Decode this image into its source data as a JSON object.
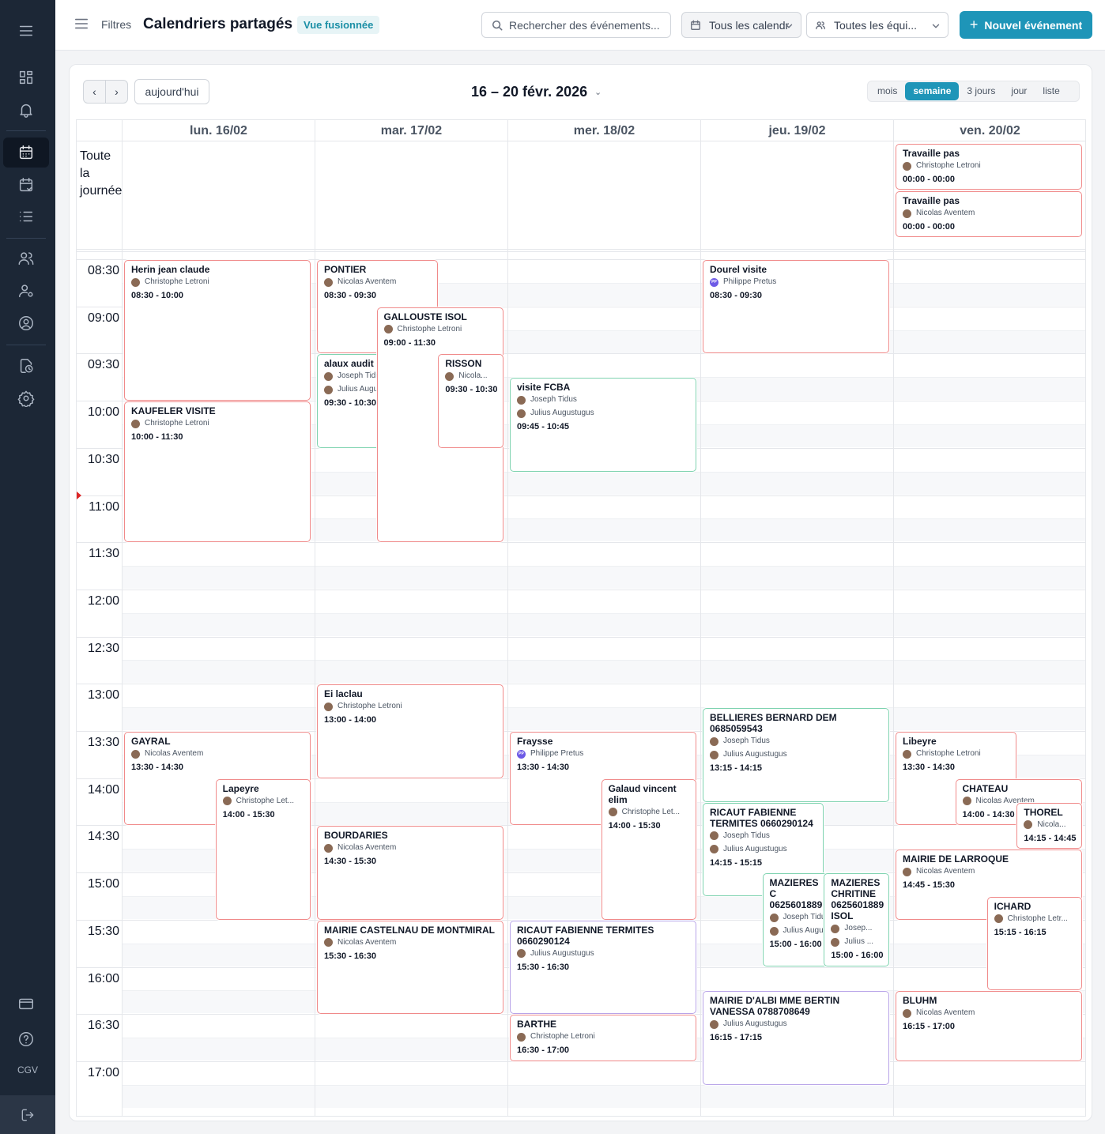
{
  "sidebar": {
    "items": [
      {
        "name": "menu-icon"
      },
      {
        "name": "dashboard-icon"
      },
      {
        "name": "bell-icon"
      },
      {
        "name": "calendar-icon"
      },
      {
        "name": "calendar-check-icon"
      },
      {
        "name": "list-icon"
      },
      {
        "name": "users-icon"
      },
      {
        "name": "user-settings-icon"
      },
      {
        "name": "user-circle-icon"
      },
      {
        "name": "document-time-icon"
      },
      {
        "name": "gear-icon"
      },
      {
        "name": "credit-card-icon"
      },
      {
        "name": "help-icon"
      }
    ],
    "cgv": "CGV",
    "logout_icon": "logout-icon"
  },
  "header": {
    "filters": "Filtres",
    "title": "Calendriers partagés",
    "badge": "Vue fusionnée",
    "search_placeholder": "Rechercher des événements...",
    "calendars_select": "Tous les calendr",
    "teams_select": "Toutes les équi...",
    "new_event": "Nouvel événement"
  },
  "toolbar": {
    "prev": "‹",
    "next": "›",
    "today": "aujourd'hui",
    "range": "16 – 20 févr. 2026",
    "views": [
      "mois",
      "semaine",
      "3 jours",
      "jour",
      "liste"
    ],
    "active_view": "semaine"
  },
  "grid": {
    "allday_label": "Toute la journée",
    "days": [
      "lun. 16/02",
      "mar. 17/02",
      "mer. 18/02",
      "jeu. 19/02",
      "ven. 20/02"
    ],
    "times": [
      "08:30",
      "09:00",
      "09:30",
      "10:00",
      "10:30",
      "11:00",
      "11:30",
      "12:00",
      "12:30",
      "13:00",
      "13:30",
      "14:00",
      "14:30",
      "15:00",
      "15:30",
      "16:00",
      "16:30",
      "17:00"
    ]
  },
  "colors": {
    "accent": "#1e95b8",
    "event_red": "#f08a8a",
    "event_green": "#7fd3b0",
    "event_purple": "#b8a4e8",
    "sidebar": "#1c2736"
  },
  "events": [
    {
      "day": 4,
      "allday": 0,
      "color": "red",
      "title": "Travaille pas",
      "people": [
        "Christophe Letroni"
      ],
      "time": "00:00 - 00:00"
    },
    {
      "day": 4,
      "allday": 1,
      "color": "red",
      "title": "Travaille pas",
      "people": [
        "Nicolas Aventem"
      ],
      "time": "00:00 - 00:00"
    },
    {
      "day": 0,
      "start": "08:30",
      "end": "10:00",
      "col": 0,
      "cols": 1,
      "color": "red",
      "title": "Herin jean claude",
      "people": [
        "Christophe Letroni"
      ],
      "time": "08:30 - 10:00"
    },
    {
      "day": 0,
      "start": "10:00",
      "end": "11:30",
      "col": 0,
      "cols": 1,
      "color": "red",
      "title": "KAUFELER VISITE",
      "people": [
        "Christophe Letroni"
      ],
      "time": "10:00 - 11:30"
    },
    {
      "day": 0,
      "start": "13:30",
      "end": "14:30",
      "col": 0,
      "cols": 1,
      "color": "red",
      "title": "GAYRAL",
      "people": [
        "Nicolas Aventem"
      ],
      "time": "13:30 - 14:30"
    },
    {
      "day": 0,
      "start": "14:00",
      "end": "15:30",
      "colL": 0.49,
      "colR": 1.0,
      "color": "red",
      "title": "Lapeyre",
      "people": [
        "Christophe Let..."
      ],
      "time": "14:00 - 15:30"
    },
    {
      "day": 1,
      "start": "08:30",
      "end": "09:30",
      "colL": 0.0,
      "colR": 0.65,
      "color": "red",
      "title": "PONTIER",
      "people": [
        "Nicolas Aventem"
      ],
      "time": "08:30 - 09:30"
    },
    {
      "day": 1,
      "start": "09:30",
      "end": "10:30",
      "colL": 0.0,
      "colR": 0.55,
      "color": "green",
      "title": "alaux audit",
      "people": [
        "Joseph Tidus",
        "Julius Augustugus"
      ],
      "time": "09:30 - 10:30"
    },
    {
      "day": 1,
      "start": "09:00",
      "end": "11:30",
      "colL": 0.32,
      "colR": 1.0,
      "color": "red",
      "title": "GALLOUSTE ISOL",
      "people": [
        "Christophe Letroni"
      ],
      "time": "09:00 - 11:30"
    },
    {
      "day": 1,
      "start": "09:30",
      "end": "10:30",
      "colL": 0.65,
      "colR": 1.0,
      "color": "red",
      "title": "RISSON",
      "people": [
        "Nicola..."
      ],
      "time": "09:30 - 10:30"
    },
    {
      "day": 1,
      "start": "13:00",
      "end": "14:00",
      "col": 0,
      "cols": 1,
      "color": "red",
      "title": "Ei laclau",
      "people": [
        "Christophe Letroni"
      ],
      "time": "13:00 - 14:00"
    },
    {
      "day": 1,
      "start": "14:30",
      "end": "15:30",
      "col": 0,
      "cols": 1,
      "color": "red",
      "title": "BOURDARIES",
      "people": [
        "Nicolas Aventem"
      ],
      "time": "14:30 - 15:30"
    },
    {
      "day": 1,
      "start": "15:30",
      "end": "16:30",
      "col": 0,
      "cols": 1,
      "color": "red",
      "title": "MAIRIE CASTELNAU DE MONTMIRAL",
      "people": [
        "Nicolas Aventem"
      ],
      "time": "15:30 - 16:30"
    },
    {
      "day": 2,
      "start": "09:45",
      "end": "10:45",
      "col": 0,
      "cols": 1,
      "color": "green",
      "title": "visite FCBA",
      "people": [
        "Joseph Tidus",
        "Julius Augustugus"
      ],
      "time": "09:45 - 10:45"
    },
    {
      "day": 2,
      "start": "13:30",
      "end": "14:30",
      "col": 0,
      "cols": 1,
      "color": "red",
      "title": "Fraysse",
      "people": [
        "PP:Philippe Pretus"
      ],
      "time": "13:30 - 14:30"
    },
    {
      "day": 2,
      "start": "14:00",
      "end": "15:30",
      "colL": 0.49,
      "colR": 1.0,
      "color": "red",
      "title": "Galaud vincent elim",
      "people": [
        "Christophe Let..."
      ],
      "time": "14:00 - 15:30"
    },
    {
      "day": 2,
      "start": "15:30",
      "end": "16:30",
      "col": 0,
      "cols": 1,
      "color": "purple",
      "title": "RICAUT FABIENNE TERMITES 0660290124",
      "people": [
        "Julius Augustugus"
      ],
      "time": "15:30 - 16:30"
    },
    {
      "day": 2,
      "start": "16:30",
      "end": "17:00",
      "col": 0,
      "cols": 1,
      "color": "red",
      "title": "BARTHE",
      "people": [
        "Christophe Letroni"
      ],
      "time": "16:30 - 17:00"
    },
    {
      "day": 3,
      "start": "08:30",
      "end": "09:30",
      "col": 0,
      "cols": 1,
      "color": "red",
      "title": "Dourel visite",
      "people": [
        "PP:Philippe Pretus"
      ],
      "time": "08:30 - 09:30"
    },
    {
      "day": 3,
      "start": "13:15",
      "end": "14:15",
      "col": 0,
      "cols": 1,
      "color": "green",
      "title": "BELLIERES BERNARD DEM 0685059543",
      "people": [
        "Joseph Tidus",
        "Julius Augustugus"
      ],
      "time": "13:15 - 14:15"
    },
    {
      "day": 3,
      "start": "14:15",
      "end": "15:15",
      "colL": 0.0,
      "colR": 0.65,
      "color": "green",
      "title": "RICAUT FABIENNE TERMITES 0660290124",
      "people": [
        "Joseph Tidus",
        "Julius Augustugus"
      ],
      "time": "14:15 - 15:15"
    },
    {
      "day": 3,
      "start": "15:00",
      "end": "16:00",
      "colL": 0.32,
      "colR": 0.68,
      "color": "green",
      "title": "MAZIERES C 0625601889",
      "people": [
        "Joseph Tidus",
        "Julius Augustugus"
      ],
      "time": "15:00 - 16:00"
    },
    {
      "day": 3,
      "start": "15:00",
      "end": "16:00",
      "colL": 0.65,
      "colR": 1.0,
      "color": "green",
      "title": "MAZIERES CHRITINE 0625601889 ISOL",
      "people": [
        "Josep...",
        "Julius ..."
      ],
      "time": "15:00 - 16:00"
    },
    {
      "day": 3,
      "start": "16:15",
      "end": "17:15",
      "col": 0,
      "cols": 1,
      "color": "purple",
      "title": "MAIRIE D'ALBI MME BERTIN VANESSA 0788708649",
      "people": [
        "Julius Augustugus"
      ],
      "time": "16:15 - 17:15"
    },
    {
      "day": 4,
      "start": "13:30",
      "end": "14:30",
      "colL": 0.0,
      "colR": 0.65,
      "color": "red",
      "title": "Libeyre",
      "people": [
        "Christophe Letroni"
      ],
      "time": "13:30 - 14:30"
    },
    {
      "day": 4,
      "start": "14:00",
      "end": "14:30",
      "colL": 0.32,
      "colR": 1.0,
      "color": "red",
      "title": "CHATEAU",
      "people": [
        "Nicolas Aventem"
      ],
      "time": "14:00 - 14:30"
    },
    {
      "day": 4,
      "start": "14:15",
      "end": "14:45",
      "colL": 0.65,
      "colR": 1.0,
      "color": "red",
      "title": "THOREL",
      "people": [
        "Nicola..."
      ],
      "time": "14:15 - 14:45"
    },
    {
      "day": 4,
      "start": "14:45",
      "end": "15:30",
      "col": 0,
      "cols": 1,
      "color": "red",
      "title": "MAIRIE DE LARROQUE",
      "people": [
        "Nicolas Aventem"
      ],
      "time": "14:45 - 15:30"
    },
    {
      "day": 4,
      "start": "15:15",
      "end": "16:15",
      "colL": 0.49,
      "colR": 1.0,
      "color": "red",
      "title": "ICHARD",
      "people": [
        "Christophe Letr..."
      ],
      "time": "15:15 - 16:15"
    },
    {
      "day": 4,
      "start": "16:15",
      "end": "17:00",
      "col": 0,
      "cols": 1,
      "color": "red",
      "title": "BLUHM",
      "people": [
        "Nicolas Aventem"
      ],
      "time": "16:15 - 17:00"
    }
  ]
}
